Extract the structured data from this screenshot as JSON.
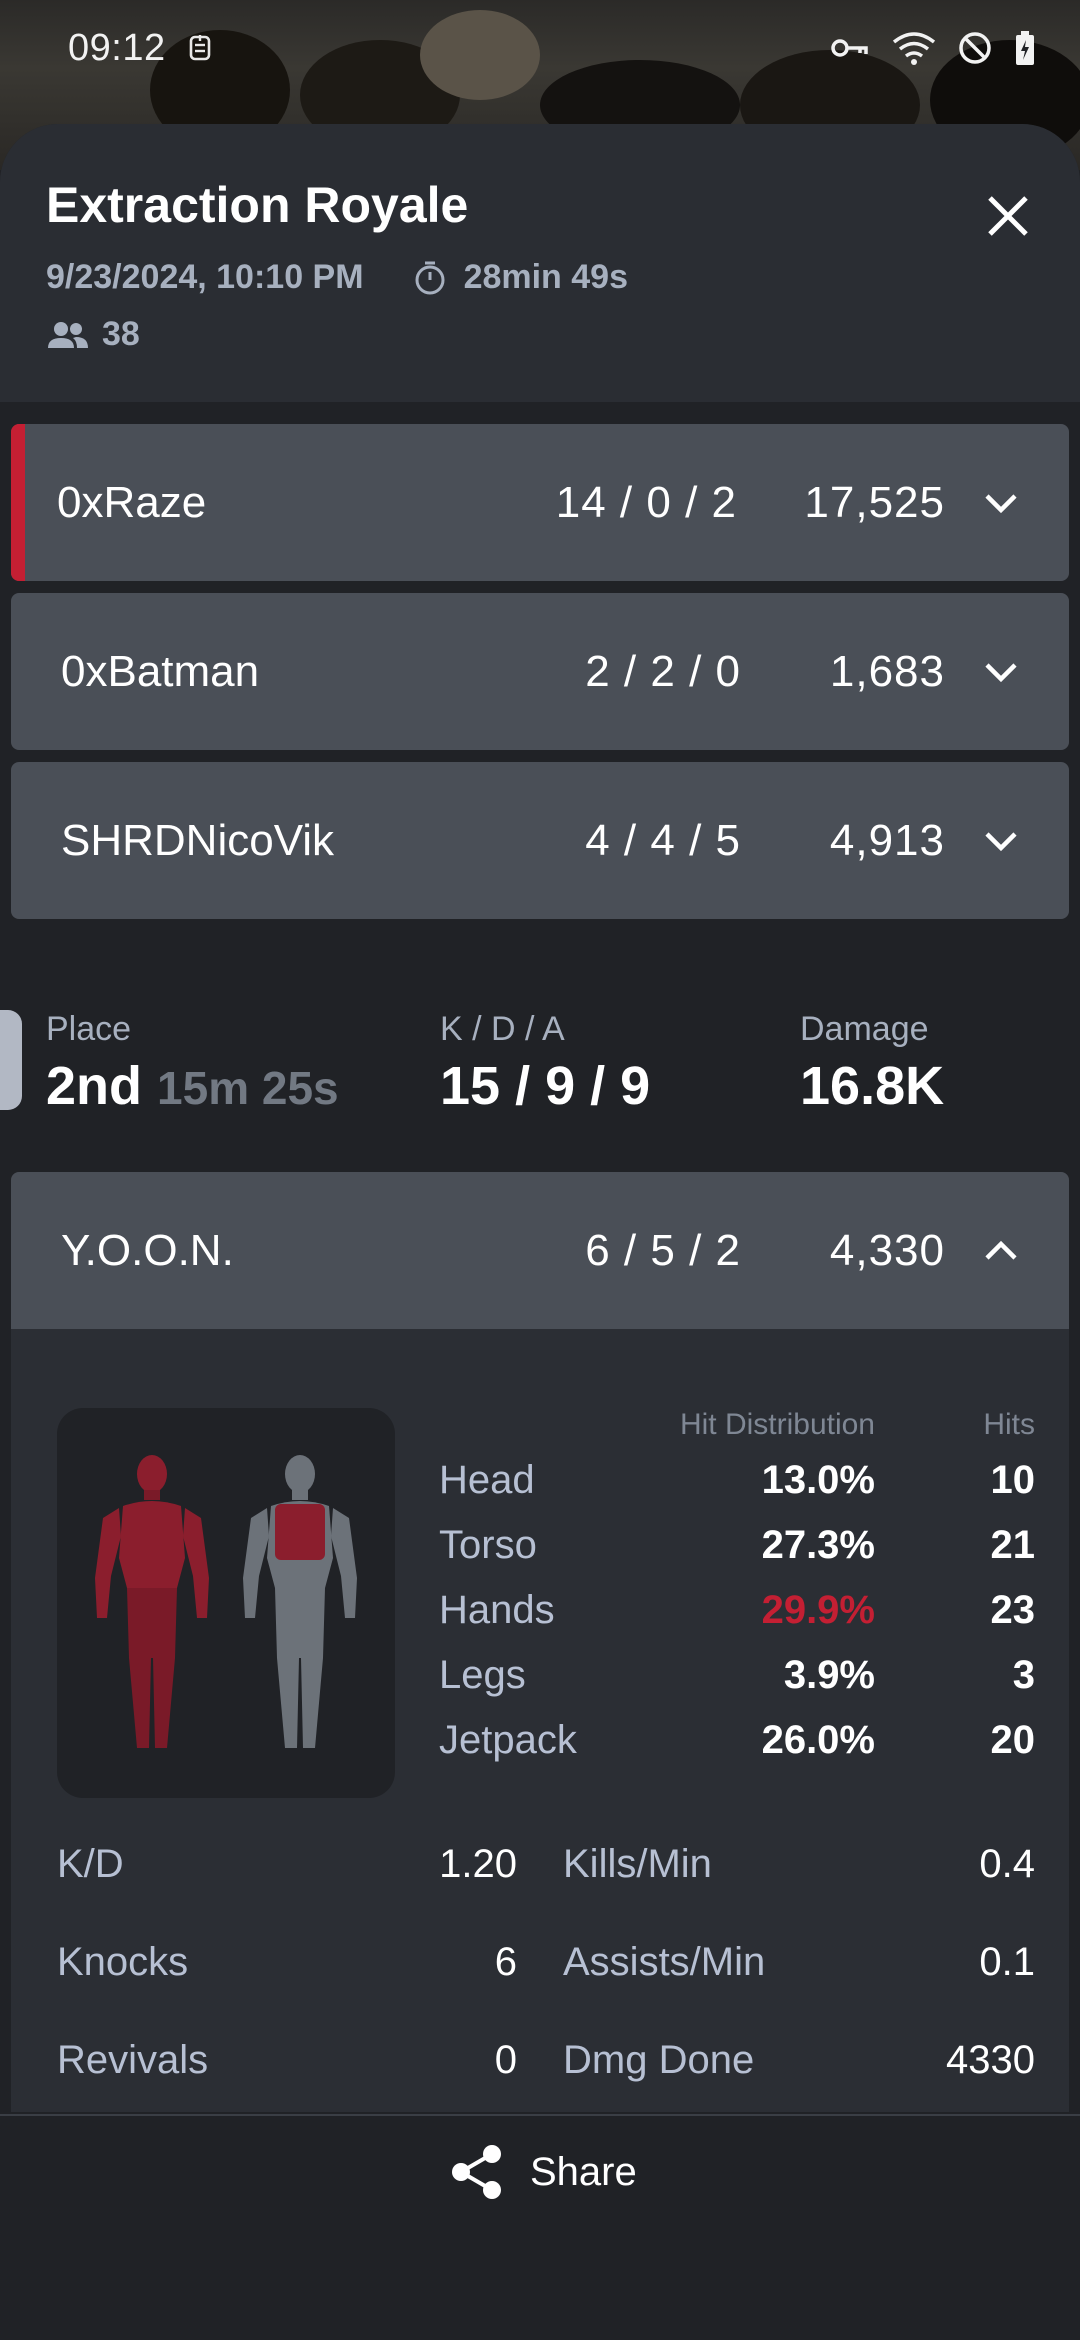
{
  "status_bar": {
    "time": "09:12",
    "left_icon": "sim-icon",
    "right_icons": [
      "key-icon",
      "wifi-icon",
      "do-not-disturb-icon",
      "battery-icon"
    ]
  },
  "header": {
    "title": "Extraction Royale",
    "datetime": "9/23/2024, 10:10 PM",
    "duration": "28min 49s",
    "players": "38",
    "close_icon": "close-icon"
  },
  "teammates": [
    {
      "name": "0xRaze",
      "kda": "14 / 0 / 2",
      "damage": "17,525",
      "highlighted": true
    },
    {
      "name": "0xBatman",
      "kda": "2 / 2 / 0",
      "damage": "1,683",
      "highlighted": false
    },
    {
      "name": "SHRDNicoVik",
      "kda": "4 / 4 / 5",
      "damage": "4,913",
      "highlighted": false
    }
  ],
  "summary": {
    "place_label": "Place",
    "place_value": "2nd",
    "place_time": "15m 25s",
    "kda_label": "K / D / A",
    "kda_value": "15 / 9 / 9",
    "damage_label": "Damage",
    "damage_value": "16.8K"
  },
  "expanded_player": {
    "name": "Y.O.O.N.",
    "kda": "6 / 5 / 2",
    "damage": "4,330",
    "hit_headers": {
      "distribution": "Hit Distribution",
      "hits": "Hits"
    },
    "hits": [
      {
        "zone": "Head",
        "pct": "13.0%",
        "count": "10",
        "hot": false
      },
      {
        "zone": "Torso",
        "pct": "27.3%",
        "count": "21",
        "hot": false
      },
      {
        "zone": "Hands",
        "pct": "29.9%",
        "count": "23",
        "hot": true
      },
      {
        "zone": "Legs",
        "pct": "3.9%",
        "count": "3",
        "hot": false
      },
      {
        "zone": "Jetpack",
        "pct": "26.0%",
        "count": "20",
        "hot": false
      }
    ],
    "stats": [
      {
        "label1": "K/D",
        "value1": "1.20",
        "label2": "Kills/Min",
        "value2": "0.4"
      },
      {
        "label1": "Knocks",
        "value1": "6",
        "label2": "Assists/Min",
        "value2": "0.1"
      },
      {
        "label1": "Revivals",
        "value1": "0",
        "label2": "Dmg Done",
        "value2": "4330"
      }
    ]
  },
  "footer": {
    "share_label": "Share",
    "share_icon": "share-icon"
  },
  "colors": {
    "accent_red": "#c41f33",
    "card_bg": "#4a4f57",
    "sheet_bg": "#202226",
    "muted_text": "#a7b0bf"
  }
}
